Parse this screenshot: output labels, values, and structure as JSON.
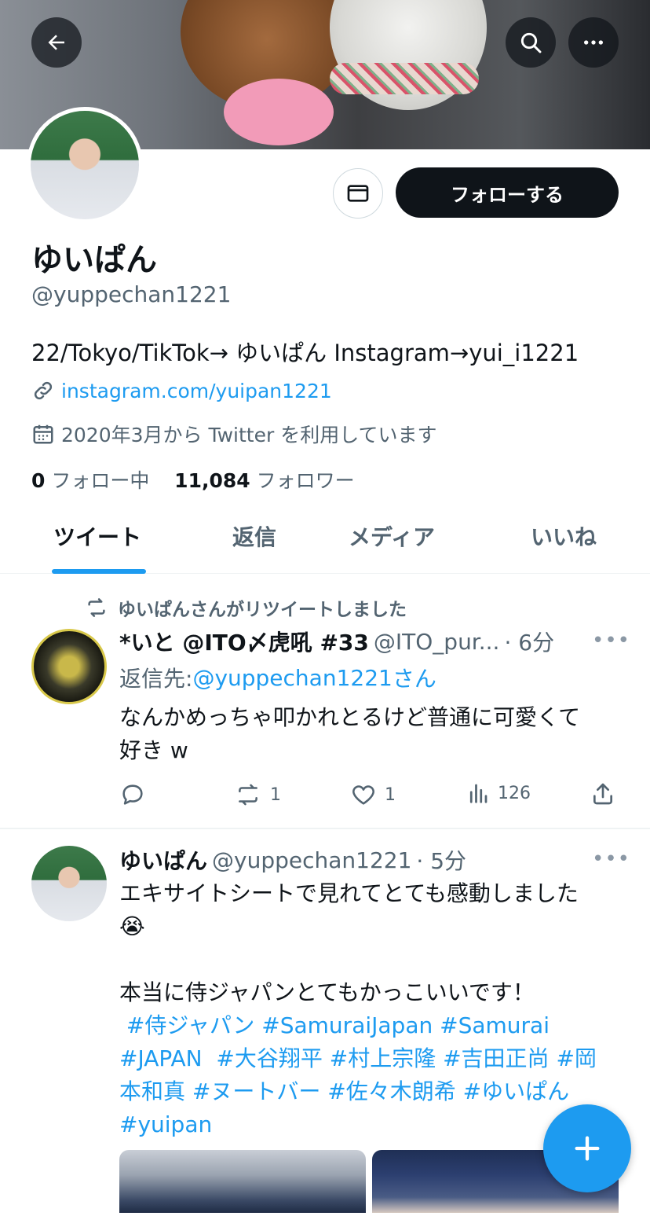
{
  "profile": {
    "name": "ゆいぱん",
    "handle": "@yuppechan1221",
    "bio": "22/Tokyo/TikTok→ ゆいぱん Instagram→yui_i1221",
    "link": "instagram.com/yuipan1221",
    "joined": "2020年3月から Twitter を利用しています",
    "following_count": "0",
    "following_label": "フォロー中",
    "followers_count": "11,084",
    "followers_label": "フォロワー",
    "follow_button": "フォローする"
  },
  "header_icons": {
    "back": "back-arrow-icon",
    "search": "search-icon",
    "more": "more-icon"
  },
  "tabs": [
    {
      "label": "ツイート",
      "active": true
    },
    {
      "label": "返信",
      "active": false
    },
    {
      "label": "メディア",
      "active": false
    },
    {
      "label": "いいね",
      "active": false
    }
  ],
  "tweets": [
    {
      "retweet_label": "ゆいぱんさんがリツイートしました",
      "name": "*いと @ITO〆虎吼 #33",
      "handle": "@ITO_pur...",
      "time": "· 6分",
      "reply_prefix": "返信先: ",
      "reply_to": "@yuppechan1221",
      "reply_suffix": "さん",
      "text_lines": [
        "なんかめっちゃ叩かれとるけど普通に可愛くて",
        "好き w"
      ],
      "replies": "",
      "retweets": "1",
      "likes": "1",
      "views": "126"
    },
    {
      "name": "ゆいぱん",
      "handle": "@yuppechan1221",
      "time": "· 5分",
      "text_line1": "エキサイトシートで見れてとても感動しました",
      "emoji": "😭",
      "text_line3": "本当に侍ジャパンとてもかっこいいです！",
      "hashtags_lines": [
        " #侍ジャパン #SamuraiJapan #Samurai",
        "#JAPAN  #大谷翔平 #村上宗隆 #吉田正尚 #岡",
        "本和真 #ヌートバー #佐々木朗希 #ゆいぱん",
        "#yuipan"
      ]
    }
  ],
  "fab": {
    "icon": "compose-plus-icon"
  },
  "colors": {
    "accent": "#1d9bf0",
    "text": "#0f1419",
    "secondary": "#536471",
    "divider": "#eff3f4"
  }
}
